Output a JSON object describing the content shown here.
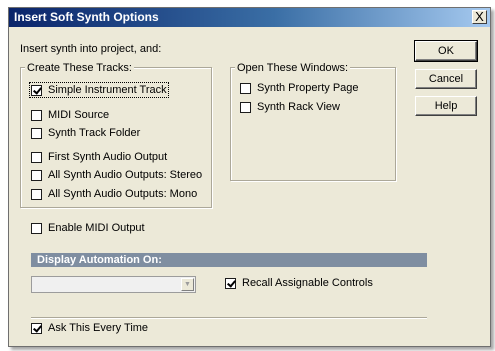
{
  "window": {
    "title": "Insert Soft Synth Options",
    "close_glyph": "X"
  },
  "intro": "Insert synth into project, and:",
  "create_tracks": {
    "label": "Create These Tracks:",
    "items": [
      {
        "label": "Simple Instrument Track",
        "checked": true
      },
      {
        "label": "MIDI Source",
        "checked": false
      },
      {
        "label": "Synth Track Folder",
        "checked": false
      },
      {
        "label": "First Synth Audio Output",
        "checked": false
      },
      {
        "label": "All Synth Audio Outputs: Stereo",
        "checked": false
      },
      {
        "label": "All Synth Audio Outputs: Mono",
        "checked": false
      }
    ]
  },
  "open_windows": {
    "label": "Open These Windows:",
    "items": [
      {
        "label": "Synth Property Page",
        "checked": false
      },
      {
        "label": "Synth Rack View",
        "checked": false
      }
    ]
  },
  "buttons": {
    "ok": "OK",
    "cancel": "Cancel",
    "help": "Help"
  },
  "enable_midi_output": {
    "label": "Enable MIDI Output",
    "checked": false
  },
  "display_automation": {
    "label": "Display Automation On:",
    "combo_value": "",
    "arrow_icon": "chevron-down-icon"
  },
  "recall_assignable": {
    "label": "Recall Assignable Controls",
    "checked": true
  },
  "ask_every_time": {
    "label": "Ask This Every Time",
    "checked": true
  },
  "colors": {
    "title_start": "#0a246a",
    "title_end": "#a6caf0",
    "dialog_bg": "#ece9d8",
    "section_header": "#7f8ea1"
  }
}
